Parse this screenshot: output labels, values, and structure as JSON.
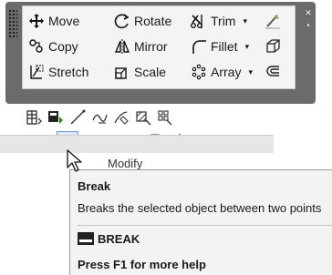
{
  "panel": {
    "commands": [
      {
        "label": "Move",
        "icon": "move-icon"
      },
      {
        "label": "Rotate",
        "icon": "rotate-icon"
      },
      {
        "label": "Trim",
        "icon": "trim-icon",
        "dropdown": true
      },
      {
        "label": "Copy",
        "icon": "copy-icon"
      },
      {
        "label": "Mirror",
        "icon": "mirror-icon"
      },
      {
        "label": "Fillet",
        "icon": "fillet-icon",
        "dropdown": true
      },
      {
        "label": "Stretch",
        "icon": "stretch-icon"
      },
      {
        "label": "Scale",
        "icon": "scale-icon"
      },
      {
        "label": "Array",
        "icon": "array-icon",
        "dropdown": true
      }
    ],
    "dropdown_glyph": "▾"
  },
  "modify": {
    "label": "Modify"
  },
  "tooltip": {
    "title": "Break",
    "description": "Breaks the selected object between two points",
    "command": "BREAK",
    "help": "Press F1 for more help"
  },
  "colors": {
    "panel_frame": "#6b6b6b",
    "highlight": "#6e9bd6",
    "tooltip_bg": "#f3f3f3"
  }
}
